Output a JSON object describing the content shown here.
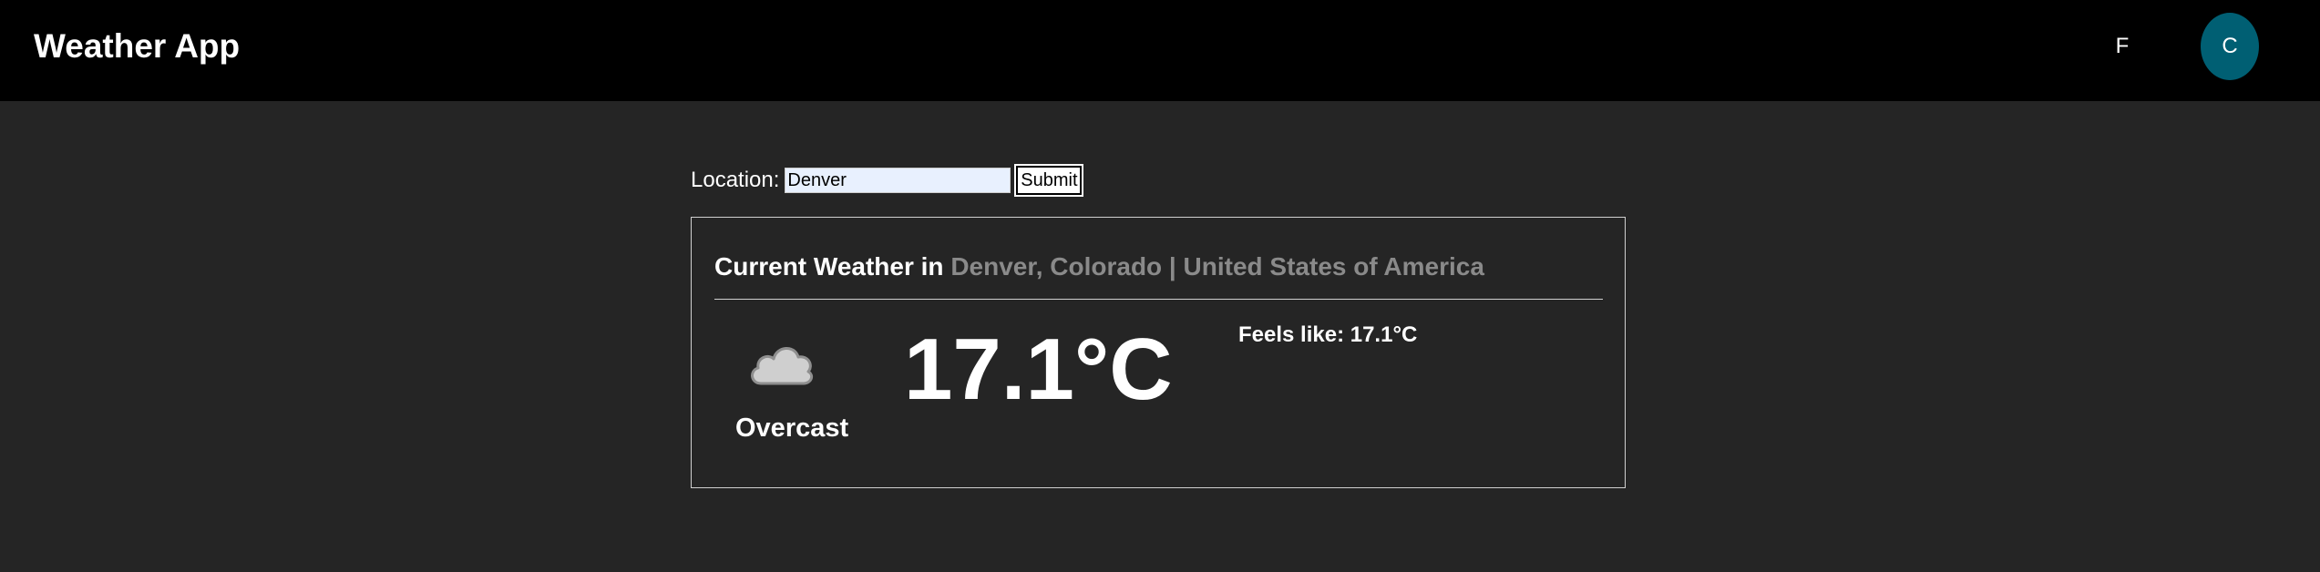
{
  "header": {
    "title": "Weather App",
    "unit_f": "F",
    "unit_c": "C",
    "active_unit": "C"
  },
  "search": {
    "label": "Location:",
    "value": "Denver",
    "submit_label": "Submit"
  },
  "weather": {
    "heading_prefix": "Current Weather in",
    "location": "Denver, Colorado | United States of America",
    "condition": "Overcast",
    "condition_icon": "cloud-icon",
    "temperature": "17.1°C",
    "feels_like": "Feels like: 17.1°C"
  },
  "colors": {
    "background": "#252525",
    "header": "#000000",
    "active_unit": "#005f73",
    "location_text": "#8a8a8a"
  }
}
